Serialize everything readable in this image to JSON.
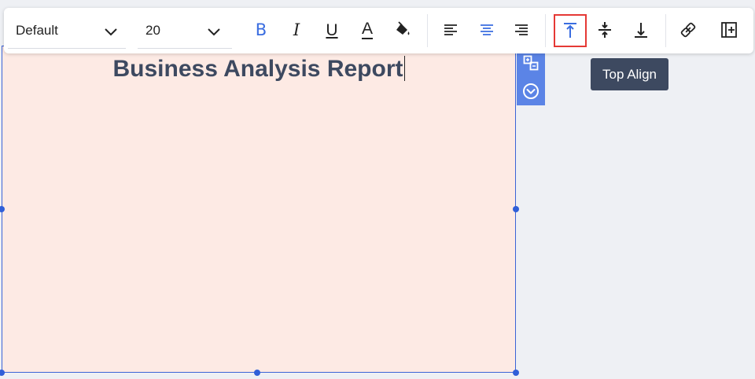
{
  "toolbar": {
    "font_family": {
      "value": "Default"
    },
    "font_size": {
      "value": "20"
    },
    "format_buttons": [
      {
        "name": "bold-button",
        "icon": "bold-icon",
        "glyph": "B",
        "active": true
      },
      {
        "name": "italic-button",
        "icon": "italic-icon",
        "glyph": "I",
        "active": false
      },
      {
        "name": "underline-button",
        "icon": "underline-icon",
        "glyph": "U",
        "active": false
      },
      {
        "name": "font-color-button",
        "icon": "font-color-icon",
        "glyph": "A",
        "active": false
      },
      {
        "name": "fill-color-button",
        "icon": "paint-bucket-icon",
        "active": false
      }
    ],
    "align_buttons": [
      {
        "name": "align-left-button",
        "icon": "align-left-icon",
        "active": false
      },
      {
        "name": "align-center-button",
        "icon": "align-center-icon",
        "active": true
      },
      {
        "name": "align-right-button",
        "icon": "align-right-icon",
        "active": false
      }
    ],
    "vertical_align_buttons": [
      {
        "name": "top-align-button",
        "icon": "top-align-icon",
        "active": true,
        "hovered": true
      },
      {
        "name": "middle-align-button",
        "icon": "middle-align-icon",
        "active": false
      },
      {
        "name": "bottom-align-button",
        "icon": "bottom-align-icon",
        "active": false
      }
    ],
    "extra_buttons": [
      {
        "name": "link-button",
        "icon": "link-icon"
      },
      {
        "name": "insert-column-button",
        "icon": "insert-column-icon"
      }
    ]
  },
  "tooltip": {
    "text": "Top Align"
  },
  "textbox": {
    "text": "Business Analysis Report"
  },
  "side_actions": [
    {
      "name": "replace-button",
      "icon": "replace-icon"
    },
    {
      "name": "more-options-button",
      "icon": "chevron-circle-down-icon"
    }
  ],
  "colors": {
    "accent": "#2f5fd8",
    "active_icon": "#3a6de0",
    "canvas_fill": "#fdeae4",
    "title_text": "#3d4960",
    "highlight_outline": "#e53935",
    "tooltip_bg": "#3d4960"
  }
}
